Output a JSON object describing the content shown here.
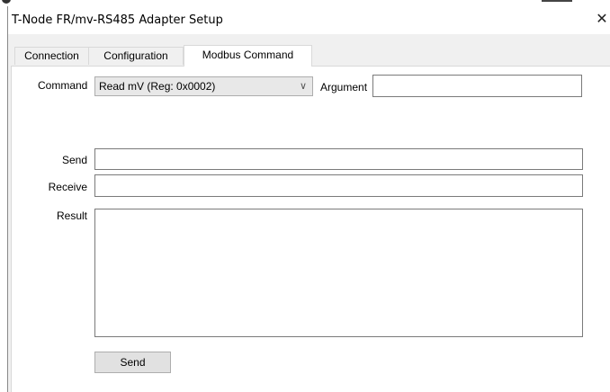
{
  "window": {
    "title": "T-Node FR/mv-RS485 Adapter Setup",
    "close_glyph": "✕"
  },
  "tabs": [
    {
      "label": "Connection",
      "active": false
    },
    {
      "label": "Configuration",
      "active": false
    },
    {
      "label": "Modbus Command",
      "active": true
    }
  ],
  "form": {
    "command_label": "Command",
    "command_value": "Read mV (Reg: 0x0002)",
    "combo_arrow": "∨",
    "argument_label": "Argument",
    "argument_value": "",
    "send_label": "Send",
    "send_value": "",
    "receive_label": "Receive",
    "receive_value": "",
    "result_label": "Result",
    "result_value": "",
    "send_button_label": "Send"
  },
  "icons": {
    "close": "close-icon",
    "dropdown": "chevron-down-icon"
  }
}
